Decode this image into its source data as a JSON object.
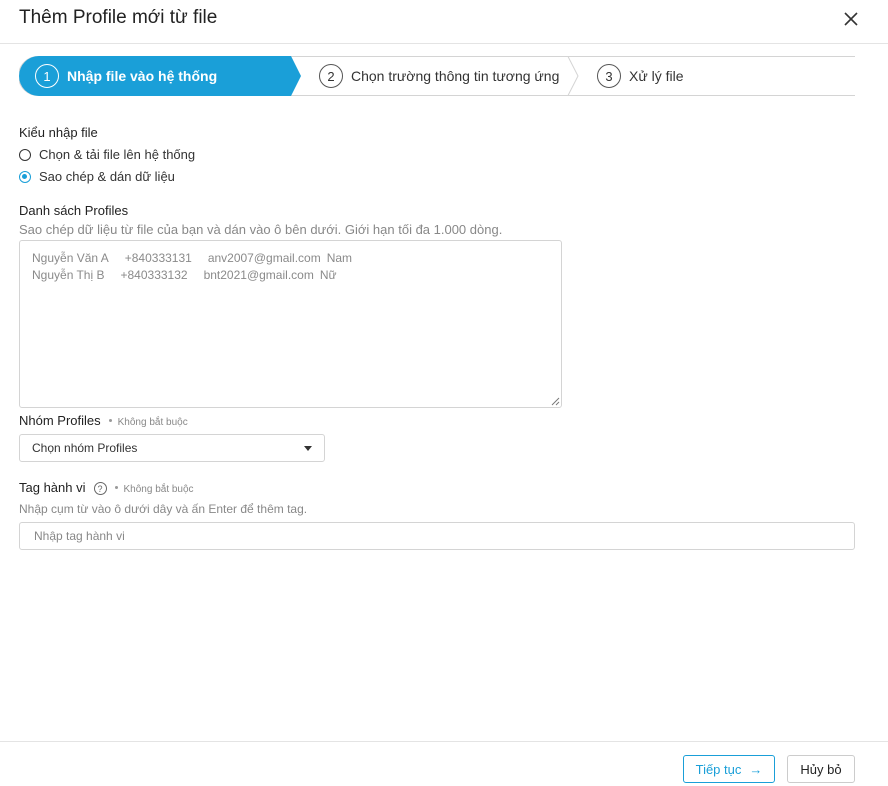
{
  "dialog": {
    "title": "Thêm Profile mới từ file"
  },
  "steps": [
    {
      "number": "1",
      "label": "Nhập file vào hệ thống",
      "active": true
    },
    {
      "number": "2",
      "label": "Chọn trường thông tin tương ứng",
      "active": false
    },
    {
      "number": "3",
      "label": "Xử lý file",
      "active": false
    }
  ],
  "import_type": {
    "label": "Kiểu nhập file",
    "options": [
      {
        "label": "Chọn & tải file lên hệ thống",
        "checked": false
      },
      {
        "label": "Sao chép & dán dữ liệu",
        "checked": true
      }
    ]
  },
  "profiles_list": {
    "label": "Danh sách Profiles",
    "hint": "Sao chép dữ liệu từ file của bạn và dán vào ô bên dưới. Giới hạn tối đa 1.000 dòng.",
    "rows": [
      {
        "name": "Nguyễn Văn A",
        "phone": "+840333131",
        "email": "anv2007@gmail.com",
        "gender": "Nam"
      },
      {
        "name": "Nguyễn Thị B",
        "phone": "+840333132",
        "email": "bnt2021@gmail.com",
        "gender": "Nữ"
      }
    ]
  },
  "profile_group": {
    "label": "Nhóm Profiles",
    "optional": "Không bắt buộc",
    "select_value": "Chọn nhóm Profiles"
  },
  "behavior_tag": {
    "label": "Tag hành vi",
    "help": "?",
    "optional": "Không bắt buộc",
    "hint": "Nhập cụm từ vào ô dưới dây và ấn Enter để thêm tag.",
    "placeholder": "Nhập tag hành vi"
  },
  "footer": {
    "next_label": "Tiếp tục",
    "next_arrow": "→",
    "cancel_label": "Hủy bỏ"
  },
  "colors": {
    "accent": "#1a9fd8",
    "border": "#d4d4d4"
  }
}
